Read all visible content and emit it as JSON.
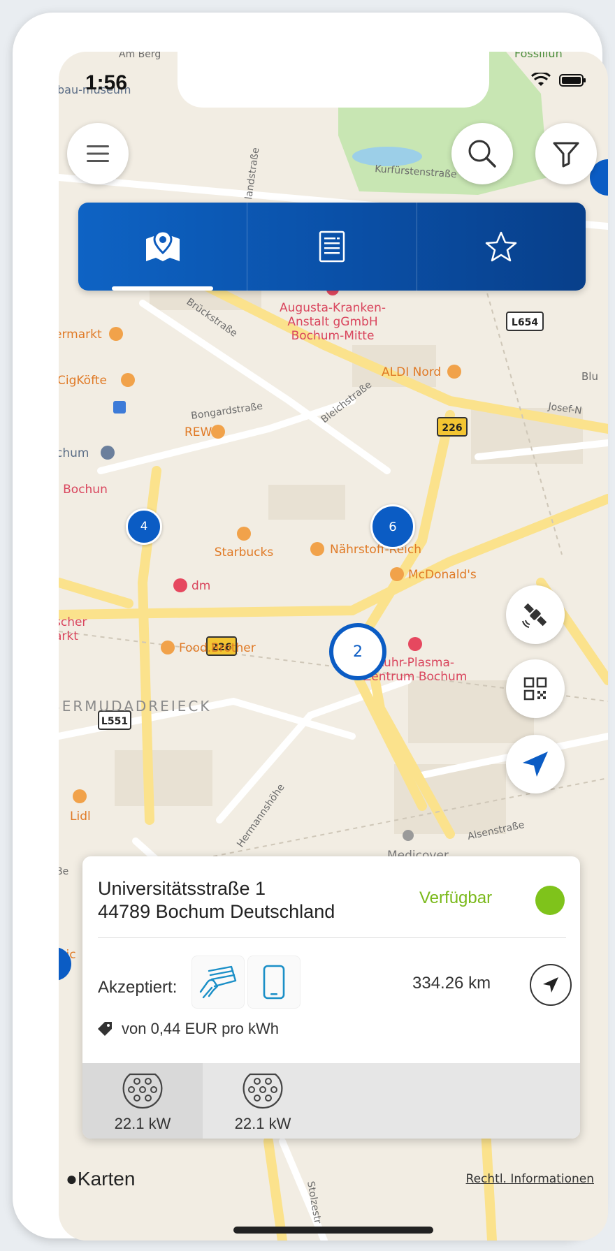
{
  "status_bar": {
    "time": "1:56"
  },
  "map": {
    "road_labels": {
      "road_1": "Kurfürstenstraße",
      "road_2": "Brückstraße",
      "road_3": "Bongardstraße",
      "road_4": "Bleichstraße",
      "road_5": "Josef-N",
      "road_6": "Hermannshöhe",
      "road_7": "Alsenstraße",
      "road_8": "Stolzestr",
      "road_9": "landstraße"
    },
    "road_badges": [
      "L654",
      "226",
      "226",
      "L551"
    ],
    "pois": {
      "poi_1": "Augusta-Kranken-",
      "poi_2": "Anstalt gGmbH",
      "poi_3": "Bochum-Mitte",
      "poi_4": "ALDI Nord",
      "poi_5": "REWE",
      "poi_6": "Starbucks",
      "poi_7": "Nährstoff-Reich",
      "poi_8": "McDonald's",
      "poi_9": "dm",
      "poi_10": "Food.Brother",
      "poi_11": "Ruhr-Plasma-",
      "poi_12": "Zentrum Bochum",
      "poi_13": "Lidl",
      "poi_14": "Medicover",
      "poi_15": "CigKöfte",
      "poi_16": "ermarkt",
      "poi_17": "chum",
      "poi_18": "ı Bochun",
      "poi_19": "scher",
      "poi_20": "arkt",
      "poi_21": "bau-museum",
      "poi_22": "Fossiliun",
      "poi_23": "Am Berg",
      "poi_24": "Blu",
      "poi_25": "mic",
      "poi_26": "Be"
    },
    "district": "BERMUDADREIECK",
    "clusters": [
      "4",
      "6",
      "2"
    ]
  },
  "tabs": [
    {
      "name": "map",
      "icon": "map-pin-icon",
      "active": true
    },
    {
      "name": "list",
      "icon": "list-document-icon",
      "active": false
    },
    {
      "name": "favorites",
      "icon": "star-icon",
      "active": false
    }
  ],
  "station": {
    "address_line1": "Universitätsstraße 1",
    "address_line2": "44789 Bochum Deutschland",
    "status": "Verfügbar",
    "status_color": "#7fc31b",
    "accepted_label": "Akzeptiert:",
    "payment_methods": [
      "card-icon",
      "phone-icon"
    ],
    "distance": "334.26 km",
    "price": "von 0,44 EUR pro kWh",
    "connectors": [
      {
        "icon": "type2-plug-icon",
        "power": "22.1 kW"
      },
      {
        "icon": "type2-plug-icon",
        "power": "22.1 kW"
      }
    ]
  },
  "attribution": {
    "brand": "Karten",
    "legal": "Rechtl. Informationen"
  },
  "colors": {
    "primary": "#0b5cc4",
    "available": "#7fc31b"
  }
}
